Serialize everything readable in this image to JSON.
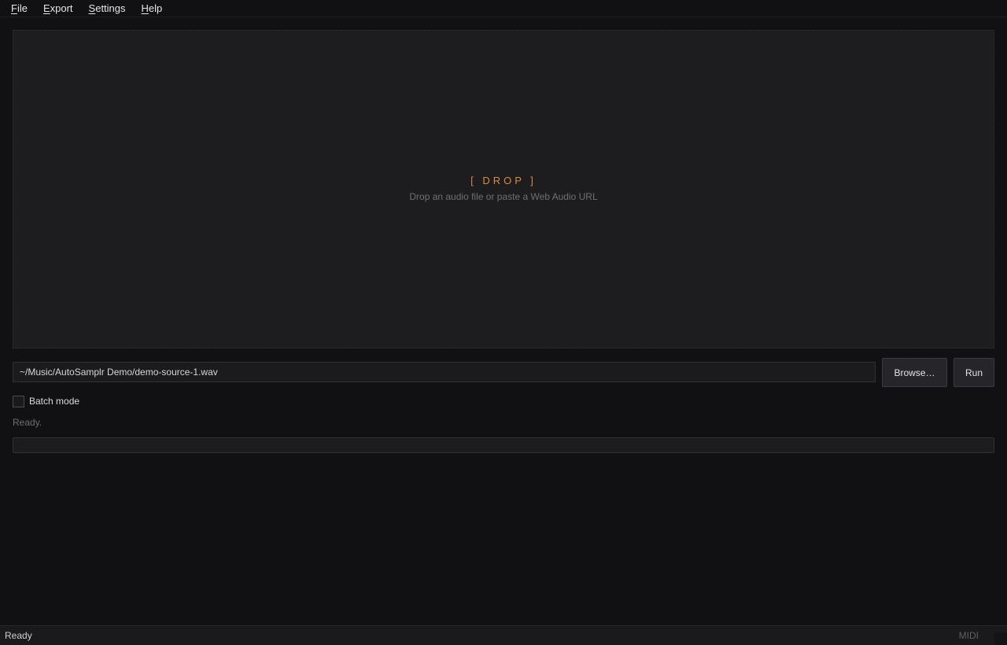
{
  "menu": [
    {
      "label": "File",
      "mnemonic": "F",
      "rest": "ile"
    },
    {
      "label": "Export",
      "mnemonic": "E",
      "rest": "xport"
    },
    {
      "label": "Settings",
      "mnemonic": "S",
      "rest": "ettings"
    },
    {
      "label": "Help",
      "mnemonic": "H",
      "rest": "elp"
    }
  ],
  "dropzone": {
    "title": "[ DROP ]",
    "hint": "Drop an audio file or paste a Web Audio URL"
  },
  "input": {
    "value": "~/Music/AutoSamplr Demo/demo-source-1.wav"
  },
  "buttons": {
    "browse": "Browse…",
    "run": "Run"
  },
  "batch": {
    "label": "Batch mode",
    "checked": false
  },
  "status": {
    "message": "Ready."
  },
  "progress": {
    "fraction": 0
  },
  "statusbar": {
    "left": "Ready",
    "midi": "MIDI"
  },
  "colors": {
    "accent": "#d88a3a",
    "background": "#111114",
    "panel": "#1d1d20"
  }
}
